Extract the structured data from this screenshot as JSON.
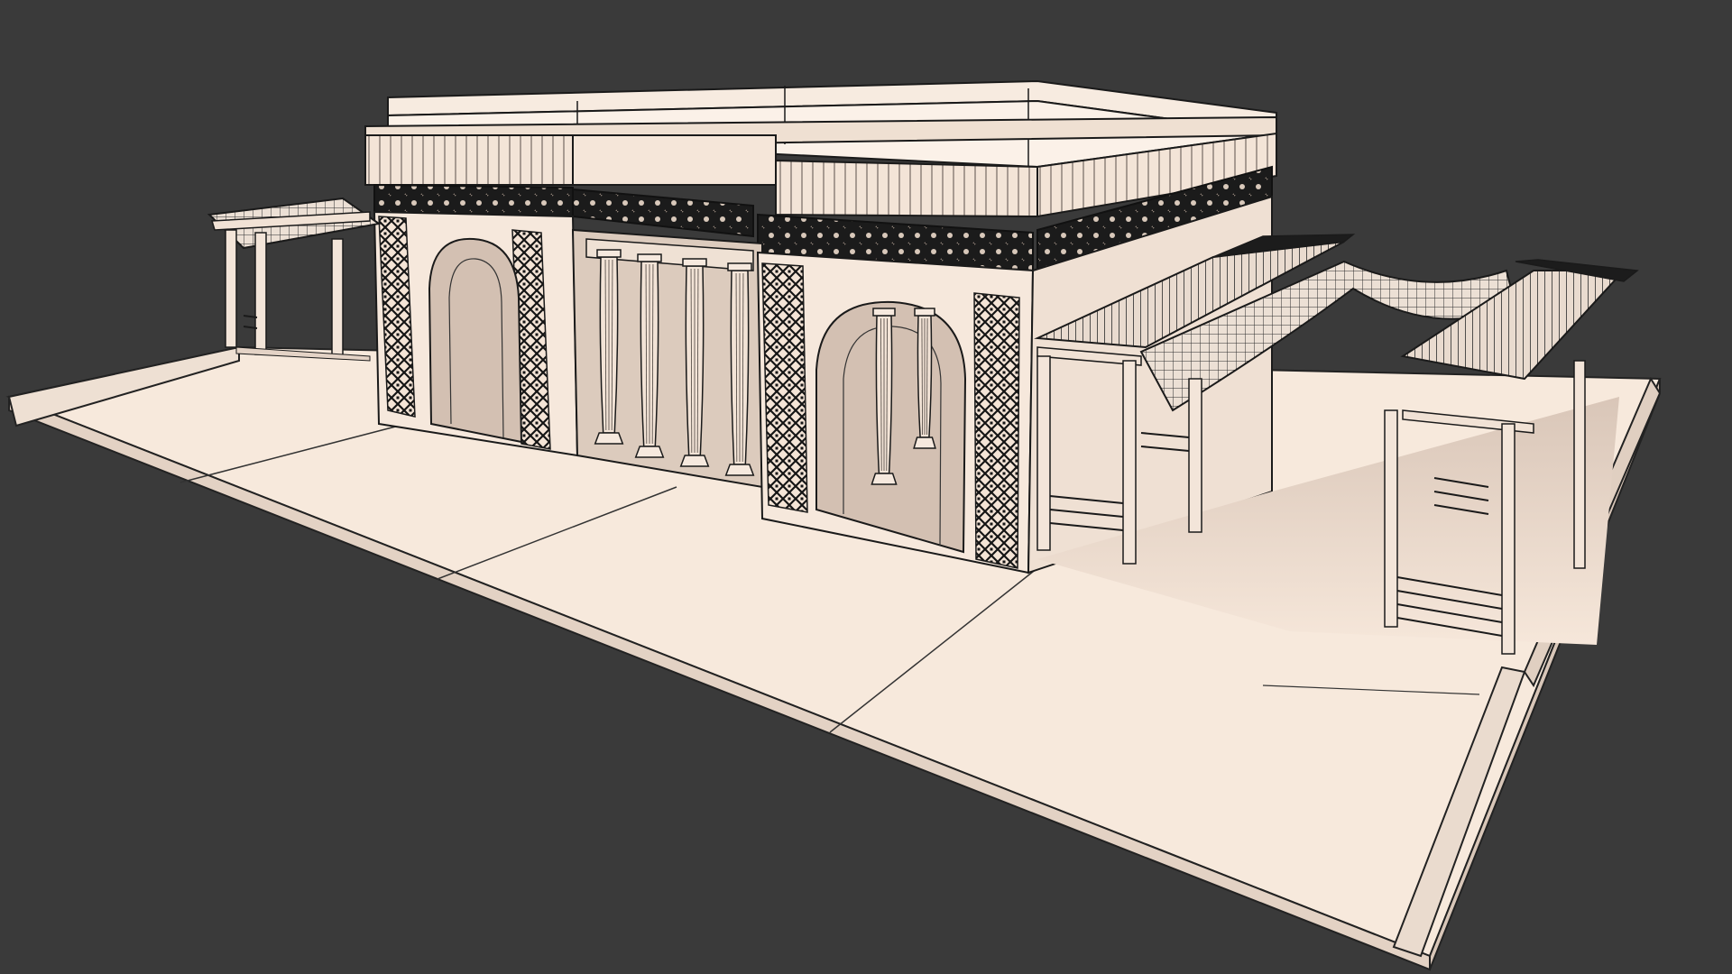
{
  "scene": {
    "background": "#3a3a3a",
    "clay_light": "#fbeee2",
    "clay_mid": "#efdccd",
    "clay_shadow": "#d2bfb1",
    "wire": "#141414",
    "band": "#1c1c1c"
  }
}
